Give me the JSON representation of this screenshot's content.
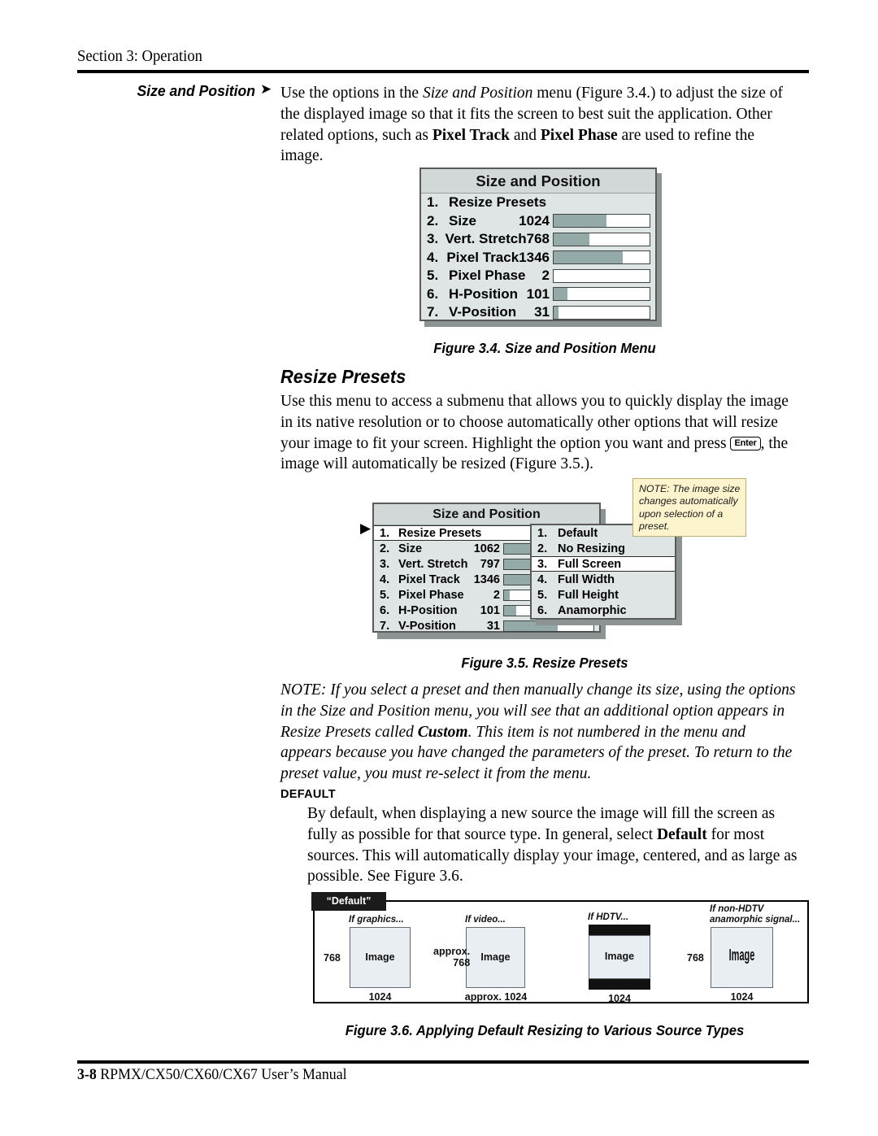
{
  "header": {
    "section": "Section 3: Operation"
  },
  "margin_heading": {
    "label": "Size and Position",
    "arrow_icon": "➤"
  },
  "intro_paragraph": {
    "lines": [
      [
        {
          "t": "Use the options in the ",
          "s": "r"
        },
        {
          "t": "Size and Position",
          "s": "i"
        },
        {
          "t": " menu (Figure 3.4.) to adjust the size of",
          "s": "r"
        }
      ],
      [
        {
          "t": "the displayed image so that it fits the screen to best suit the application. Other",
          "s": "r"
        }
      ],
      [
        {
          "t": "related options, such as ",
          "s": "r"
        },
        {
          "t": "Pixel Track",
          "s": "b"
        },
        {
          "t": " and ",
          "s": "r"
        },
        {
          "t": "Pixel Phase",
          "s": "b"
        },
        {
          "t": " are used to refine the",
          "s": "r"
        }
      ],
      [
        {
          "t": "image.",
          "s": "r"
        }
      ]
    ]
  },
  "menu_34": {
    "title": "Size and Position",
    "rows": [
      {
        "num": "1.",
        "label": "Resize Presets",
        "value": "",
        "fill_pct": null
      },
      {
        "num": "2.",
        "label": "Size",
        "value": "1024",
        "fill_pct": 55
      },
      {
        "num": "3.",
        "label": "Vert. Stretch",
        "value": "768",
        "fill_pct": 37
      },
      {
        "num": "4.",
        "label": "Pixel Track",
        "value": "1346",
        "fill_pct": 72
      },
      {
        "num": "5.",
        "label": "Pixel Phase",
        "value": "2",
        "fill_pct": 0
      },
      {
        "num": "6.",
        "label": "H-Position",
        "value": "101",
        "fill_pct": 14
      },
      {
        "num": "7.",
        "label": "V-Position",
        "value": "31",
        "fill_pct": 5
      }
    ]
  },
  "caption_34": "Figure 3.4. Size and Position Menu",
  "heading_resize_presets": "Resize Presets",
  "resize_paragraph": {
    "lines": [
      [
        {
          "t": "Use this menu to access a submenu that allows you to quickly display the image",
          "s": "r"
        }
      ],
      [
        {
          "t": "in its native resolution or to choose automatically other options that will resize",
          "s": "r"
        }
      ],
      [
        {
          "t": "your image to fit your screen. Highlight the option you want and press ",
          "s": "r"
        },
        {
          "t": "Enter",
          "s": "key"
        },
        {
          "t": ", the",
          "s": "r"
        }
      ],
      [
        {
          "t": "image will automatically be resized (Figure 3.5.).",
          "s": "r"
        }
      ]
    ]
  },
  "menu_35": {
    "title": "Size and Position",
    "selected_arrow_icon": "▶",
    "rows": [
      {
        "num": "1.",
        "label": "Resize Presets",
        "value": "",
        "fill_pct": null,
        "selected": true
      },
      {
        "num": "2.",
        "label": "Size",
        "value": "1062",
        "fill_pct": 52,
        "selected": false
      },
      {
        "num": "3.",
        "label": "Vert. Stretch",
        "value": "797",
        "fill_pct": 40,
        "selected": false
      },
      {
        "num": "4.",
        "label": "Pixel Track",
        "value": "1346",
        "fill_pct": 72,
        "selected": false
      },
      {
        "num": "5.",
        "label": "Pixel Phase",
        "value": "2",
        "fill_pct": 6,
        "selected": false
      },
      {
        "num": "6.",
        "label": "H-Position",
        "value": "101",
        "fill_pct": 14,
        "selected": false
      },
      {
        "num": "7.",
        "label": "V-Position",
        "value": "31",
        "fill_pct": 60,
        "selected": false
      }
    ]
  },
  "submenu_35": {
    "items": [
      {
        "num": "1.",
        "label": "Default",
        "selected": false
      },
      {
        "num": "2.",
        "label": "No Resizing",
        "selected": false
      },
      {
        "num": "3.",
        "label": "Full Screen",
        "selected": true
      },
      {
        "num": "4.",
        "label": "Full Width",
        "selected": false
      },
      {
        "num": "5.",
        "label": "Full Height",
        "selected": false
      },
      {
        "num": "6.",
        "label": "Anamorphic",
        "selected": false
      }
    ]
  },
  "note_callout": {
    "lines": [
      "NOTE: The image size",
      "changes automatically",
      "upon selection of a",
      "preset."
    ]
  },
  "caption_35": "Figure 3.5. Resize Presets",
  "note_paragraph": {
    "lines": [
      [
        {
          "t": "NOTE: If you select a preset and then manually change its size, using the options",
          "s": "i"
        }
      ],
      [
        {
          "t": "in the Size and Position menu, you will see that an additional option appears in",
          "s": "i"
        }
      ],
      [
        {
          "t": "Resize Presets called ",
          "s": "i"
        },
        {
          "t": "Custom",
          "s": "bi"
        },
        {
          "t": ". This item is not numbered in the menu and",
          "s": "i"
        }
      ],
      [
        {
          "t": "appears because you have changed the parameters of the preset. To return to the",
          "s": "i"
        }
      ],
      [
        {
          "t": "preset value, you must re-select it from the menu.",
          "s": "i"
        }
      ]
    ]
  },
  "default_heading": "DEFAULT",
  "default_paragraph": {
    "lines": [
      [
        {
          "t": "By default, when displaying a new source the image will fill the screen as",
          "s": "r"
        }
      ],
      [
        {
          "t": "fully as possible for that source type. In general, select ",
          "s": "r"
        },
        {
          "t": "Default",
          "s": "b"
        },
        {
          "t": " for most",
          "s": "r"
        }
      ],
      [
        {
          "t": "sources. This will automatically display your image, centered, and as large as",
          "s": "r"
        }
      ],
      [
        {
          "t": "possible. See Figure 3.6.",
          "s": "r"
        }
      ]
    ]
  },
  "diagram_36": {
    "tag_label": "“Default”",
    "panels": [
      {
        "caption": [
          "If graphics..."
        ],
        "height_label": "768",
        "width_label": "1024",
        "image_label": "Image",
        "style": "plain"
      },
      {
        "caption": [
          "If video..."
        ],
        "height_label": "approx.\n768",
        "width_label": "approx. 1024",
        "image_label": "Image",
        "style": "plain"
      },
      {
        "caption": [
          "If HDTV..."
        ],
        "height_label": "",
        "width_label": "1024",
        "image_label": "Image",
        "style": "letterbox"
      },
      {
        "caption": [
          "If non-HDTV",
          "anamorphic signal..."
        ],
        "height_label": "768",
        "width_label": "1024",
        "image_label": "Image",
        "style": "anamorphic"
      }
    ]
  },
  "caption_36": "Figure 3.6. Applying Default Resizing to Various Source Types",
  "footer": {
    "page_number": "3-8",
    "manual_title": "RPMX/CX50/CX60/CX67 User’s Manual"
  }
}
